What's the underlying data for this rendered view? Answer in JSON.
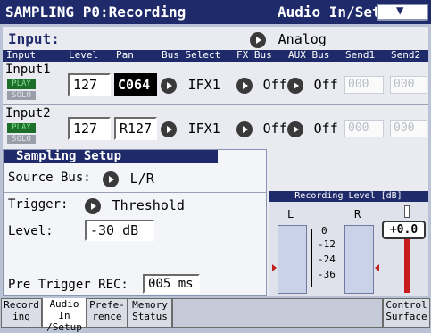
{
  "title": {
    "left": "SAMPLING P0:Recording",
    "right": "Audio In/Setup"
  },
  "input_section": {
    "label": "Input:",
    "source": "Analog"
  },
  "columns": [
    "Input",
    "Level",
    "Pan",
    "Bus Select",
    "FX Bus",
    "AUX Bus",
    "Send1",
    "Send2"
  ],
  "inputs": [
    {
      "name": "Input1",
      "play": "PLAY",
      "solo": "SOLO",
      "level": "127",
      "pan": "C064",
      "bus": "IFX1",
      "fx": "Off",
      "aux": "Off",
      "send1": "000",
      "send2": "000"
    },
    {
      "name": "Input2",
      "play": "PLAY",
      "solo": "SOLO",
      "level": "127",
      "pan": "R127",
      "bus": "IFX1",
      "fx": "Off",
      "aux": "Off",
      "send1": "000",
      "send2": "000"
    }
  ],
  "sampling_setup": {
    "title": "Sampling Setup",
    "source_bus_label": "Source Bus:",
    "source_bus_value": "L/R",
    "trigger_label": "Trigger:",
    "trigger_value": "Threshold",
    "level_label": "Level:",
    "level_value": "-30 dB",
    "pre_trigger_label": "Pre Trigger REC:",
    "pre_trigger_value": "005 ms"
  },
  "recording_level": {
    "title": "Recording Level [dB]",
    "left_label": "L",
    "right_label": "R",
    "ticks": [
      "0",
      "-12",
      "-24",
      "-36"
    ],
    "gain_value": "+0.0"
  },
  "tabs": [
    {
      "line1": "Record",
      "line2": "ing"
    },
    {
      "line1": "Audio In",
      "line2": "/Setup"
    },
    {
      "line1": "Prefe-",
      "line2": "rence"
    },
    {
      "line1": "Memory",
      "line2": "Status"
    },
    {
      "line1": "Control",
      "line2": "Surface"
    }
  ]
}
